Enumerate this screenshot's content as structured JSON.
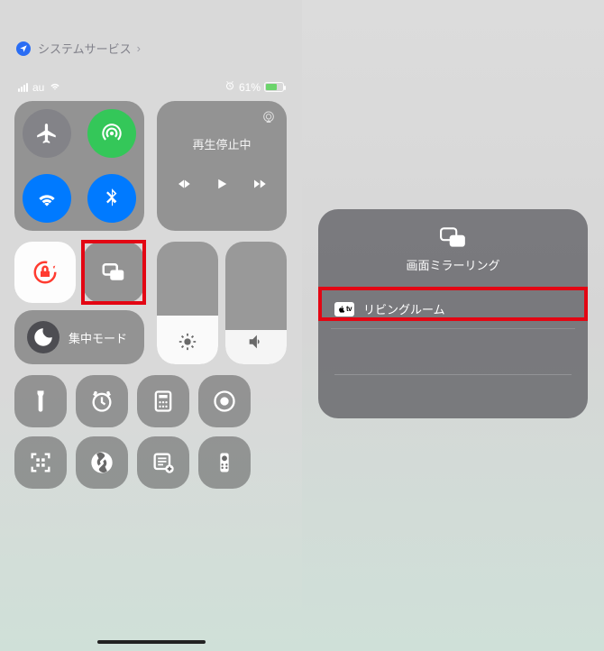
{
  "settings_row": {
    "label": "システムサービス"
  },
  "status": {
    "carrier": "au",
    "battery_pct": "61%",
    "alarm_icon": "alarm-icon"
  },
  "connectivity": {
    "airplane": "airplane-icon",
    "cellular": "cellular-icon",
    "wifi": "wifi-icon",
    "bluetooth": "bluetooth-icon"
  },
  "media": {
    "status_text": "再生停止中",
    "prev": "prev",
    "play": "play",
    "next": "next"
  },
  "focus": {
    "label": "集中モード"
  },
  "mirroring_panel": {
    "title": "画面ミラーリング",
    "devices": [
      {
        "badge": "tv",
        "name": "リビングルーム"
      }
    ]
  }
}
